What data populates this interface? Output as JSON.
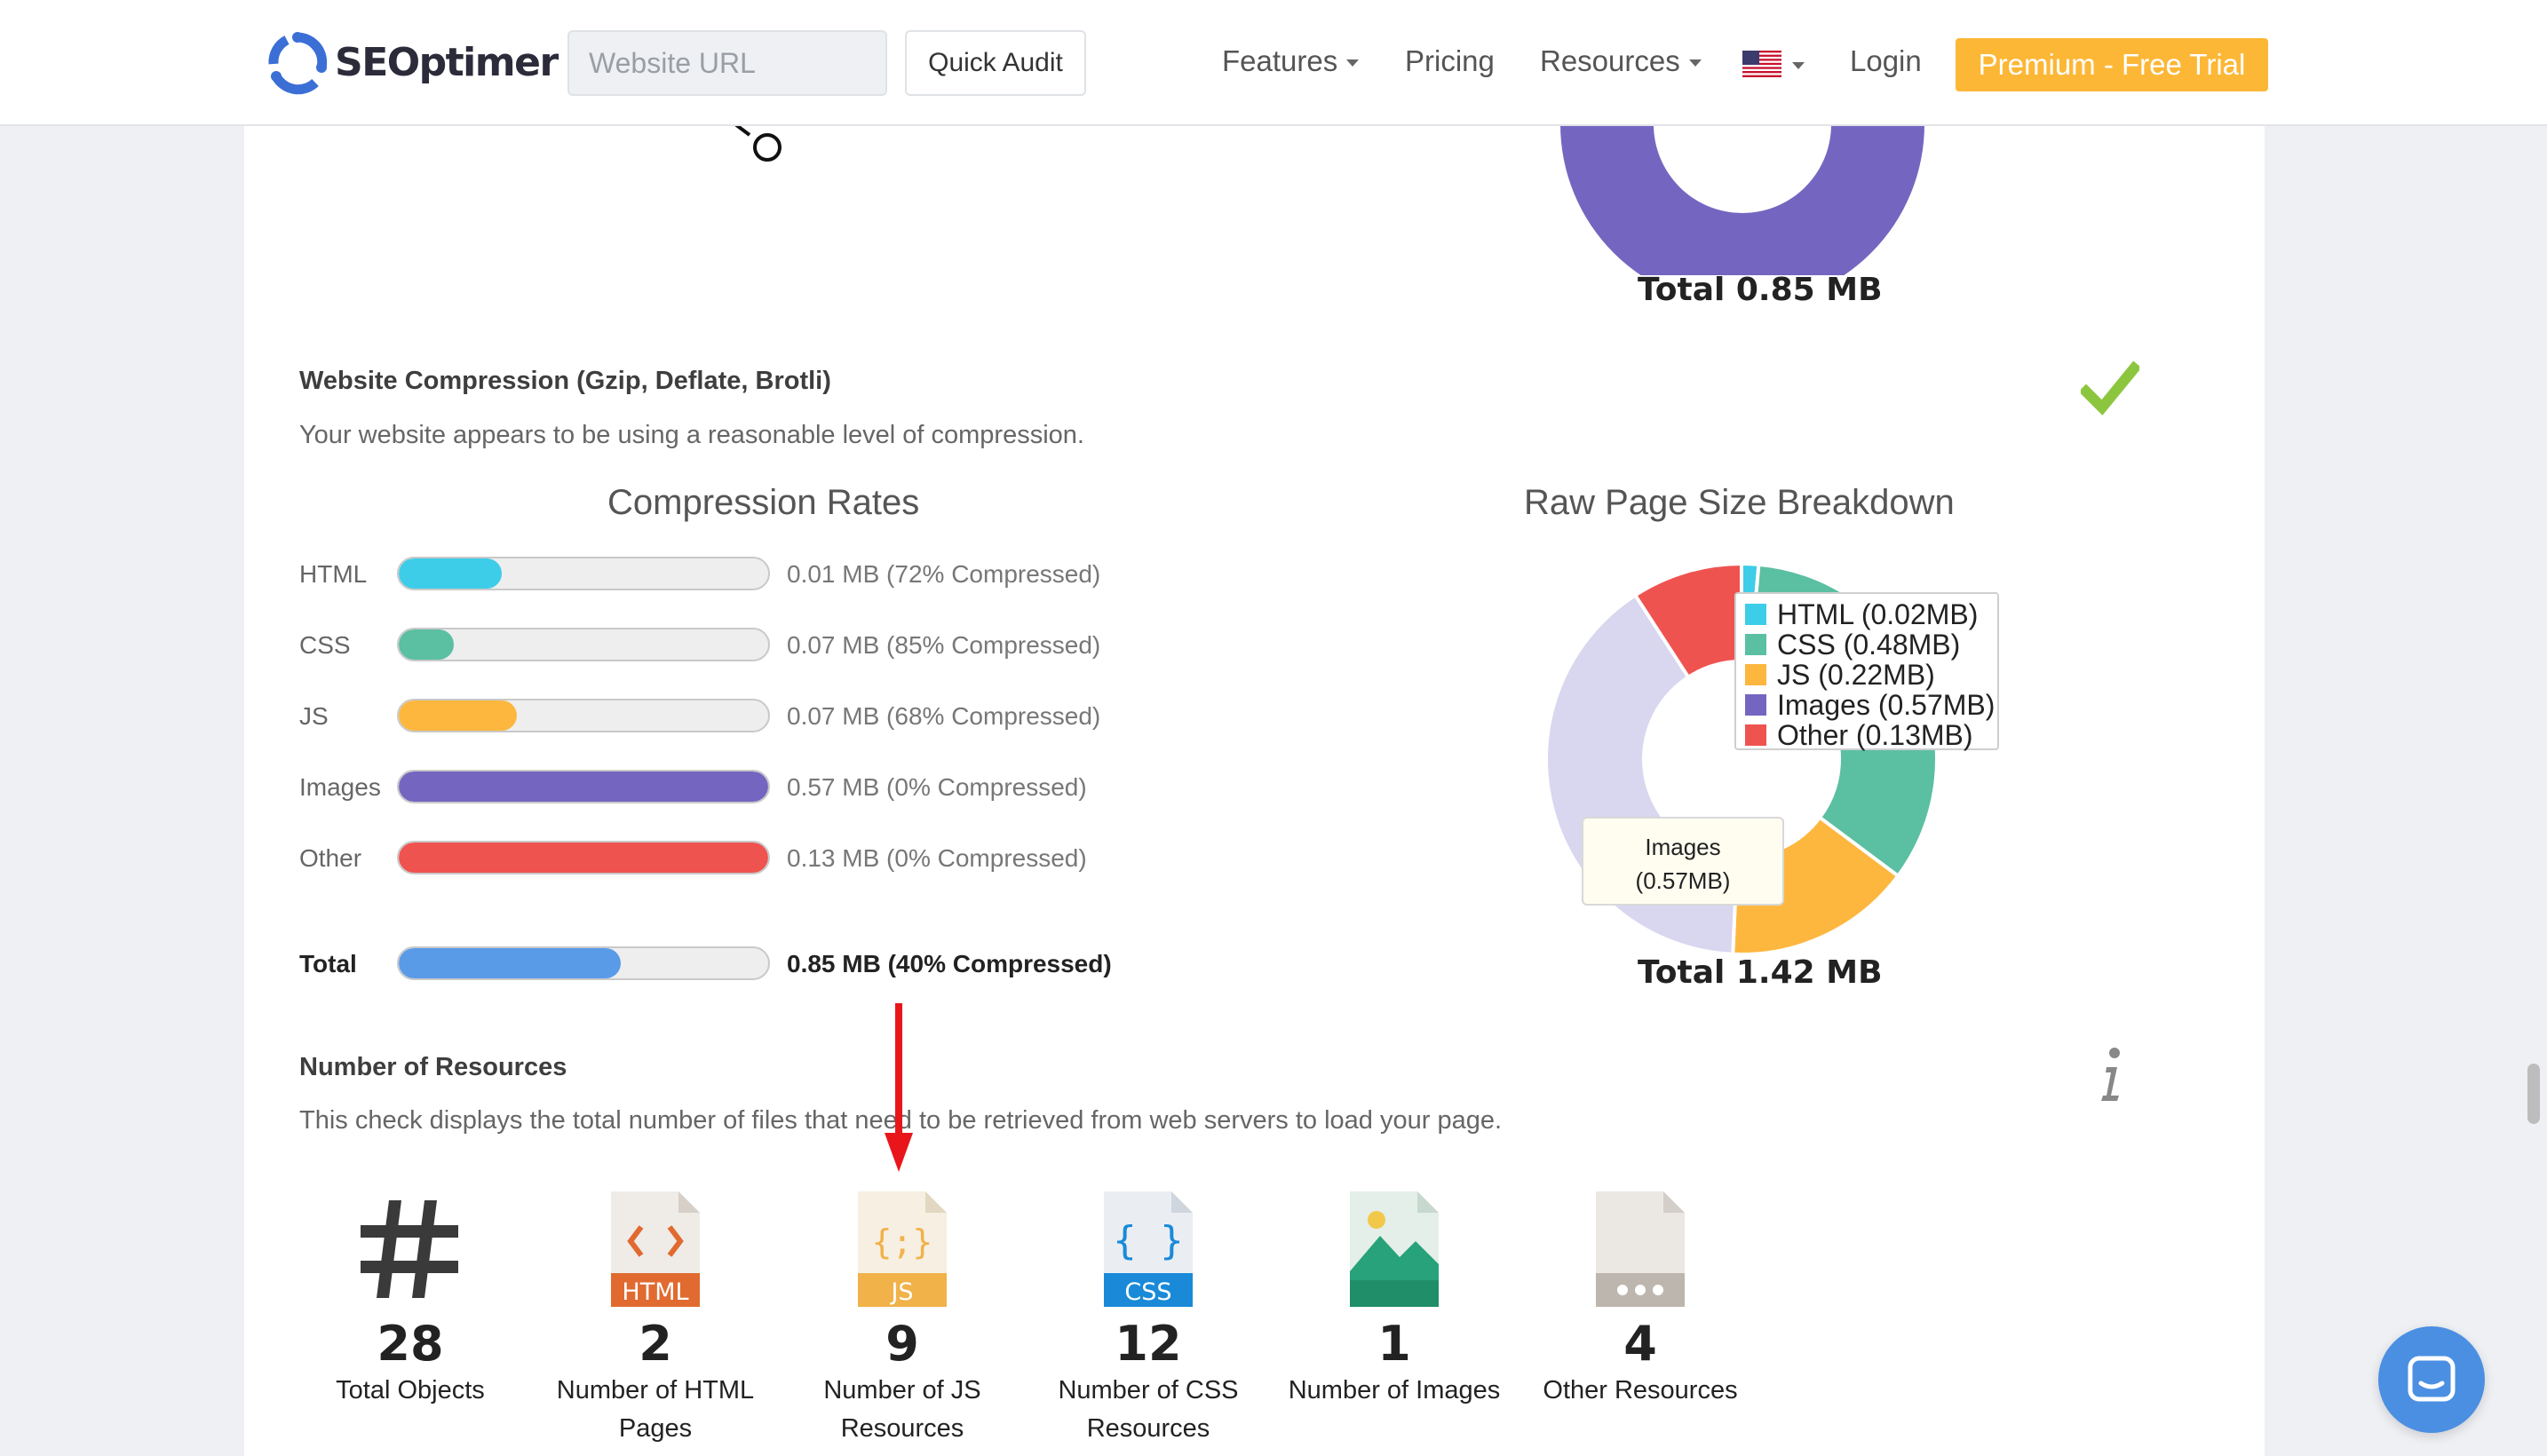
{
  "header": {
    "logo_text": "SEOptimer",
    "url_placeholder": "Website URL",
    "quick_audit": "Quick Audit",
    "nav": {
      "features": "Features",
      "pricing": "Pricing",
      "resources": "Resources",
      "login": "Login"
    },
    "premium": "Premium - Free Trial"
  },
  "top_donut": {
    "total": "Total 0.85 MB",
    "color": "#7466c0"
  },
  "compression": {
    "title": "Website Compression (Gzip, Deflate, Brotli)",
    "description": "Your website appears to be using a reasonable level of compression.",
    "status_icon": "checkmark-icon",
    "status_color": "#8cc63f",
    "chart_title": "Compression Rates",
    "bars": [
      {
        "label": "HTML",
        "value": "0.01 MB (72% Compressed)",
        "fill": 0.28,
        "color": "#3ecde8"
      },
      {
        "label": "CSS",
        "value": "0.07 MB (85% Compressed)",
        "fill": 0.15,
        "color": "#5bbfa2"
      },
      {
        "label": "JS",
        "value": "0.07 MB (68% Compressed)",
        "fill": 0.32,
        "color": "#fdb73f"
      },
      {
        "label": "Images",
        "value": "0.57 MB (0% Compressed)",
        "fill": 1.0,
        "color": "#7466c0"
      },
      {
        "label": "Other",
        "value": "0.13 MB (0% Compressed)",
        "fill": 1.0,
        "color": "#ef5350"
      }
    ],
    "total": {
      "label": "Total",
      "value": "0.85 MB (40% Compressed)",
      "fill": 0.6,
      "color": "#5a9be8"
    }
  },
  "raw_breakdown": {
    "chart_title": "Raw Page Size Breakdown",
    "legend": [
      {
        "label": "HTML (0.02MB)",
        "value": 0.02,
        "color": "#3ecde8"
      },
      {
        "label": "CSS (0.48MB)",
        "value": 0.48,
        "color": "#5bbfa2"
      },
      {
        "label": "JS (0.22MB)",
        "value": 0.22,
        "color": "#fdb73f"
      },
      {
        "label": "Images (0.57MB)",
        "value": 0.57,
        "color": "#d9d6ef"
      },
      {
        "label": "Other (0.13MB)",
        "value": 0.13,
        "color": "#ef5350"
      }
    ],
    "tooltip_line1": "Images",
    "tooltip_line2": "(0.57MB)",
    "total": "Total 1.42 MB"
  },
  "resources": {
    "title": "Number of Resources",
    "description": "This check displays the total number of files that need to be retrieved from web servers to load your page.",
    "info_icon": "info-icon",
    "items": [
      {
        "icon": "hash-icon",
        "count": "28",
        "label_1": "Total Objects",
        "label_2": ""
      },
      {
        "icon": "html-file-icon",
        "count": "2",
        "label_1": "Number of HTML",
        "label_2": "Pages"
      },
      {
        "icon": "js-file-icon",
        "count": "9",
        "label_1": "Number of JS",
        "label_2": "Resources"
      },
      {
        "icon": "css-file-icon",
        "count": "12",
        "label_1": "Number of CSS",
        "label_2": "Resources"
      },
      {
        "icon": "image-file-icon",
        "count": "1",
        "label_1": "Number of Images",
        "label_2": ""
      },
      {
        "icon": "other-file-icon",
        "count": "4",
        "label_1": "Other Resources",
        "label_2": ""
      }
    ],
    "file_badges": {
      "html": "HTML",
      "js": "JS",
      "css": "CSS"
    }
  }
}
